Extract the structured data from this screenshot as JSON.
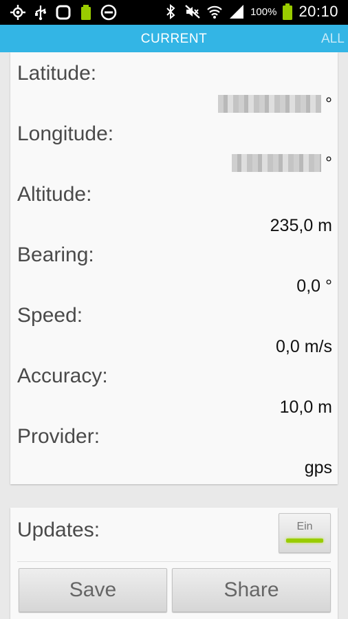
{
  "status_bar": {
    "icons_left": [
      "gps-icon",
      "usb-icon",
      "screen-icon",
      "battery-charging-icon",
      "do-not-disturb-icon"
    ],
    "icons_right": [
      "bluetooth-icon",
      "mute-icon",
      "wifi-icon",
      "signal-icon"
    ],
    "battery_percent": "100%",
    "time": "20:10"
  },
  "tabs": {
    "current": "CURRENT",
    "all": "ALL",
    "accent_color": "#33b5e5"
  },
  "location": {
    "latitude": {
      "label": "Latitude:",
      "value_unit": "°"
    },
    "longitude": {
      "label": "Longitude:",
      "value_unit": "°"
    },
    "altitude": {
      "label": "Altitude:",
      "value": "235,0 m"
    },
    "bearing": {
      "label": "Bearing:",
      "value": "0,0 °"
    },
    "speed": {
      "label": "Speed:",
      "value": "0,0 m/s"
    },
    "accuracy": {
      "label": "Accuracy:",
      "value": "10,0 m"
    },
    "provider": {
      "label": "Provider:",
      "value": "gps"
    }
  },
  "updates": {
    "label": "Updates:",
    "toggle_label": "Ein",
    "toggle_color": "#99cc00"
  },
  "actions": {
    "save": "Save",
    "share": "Share"
  }
}
